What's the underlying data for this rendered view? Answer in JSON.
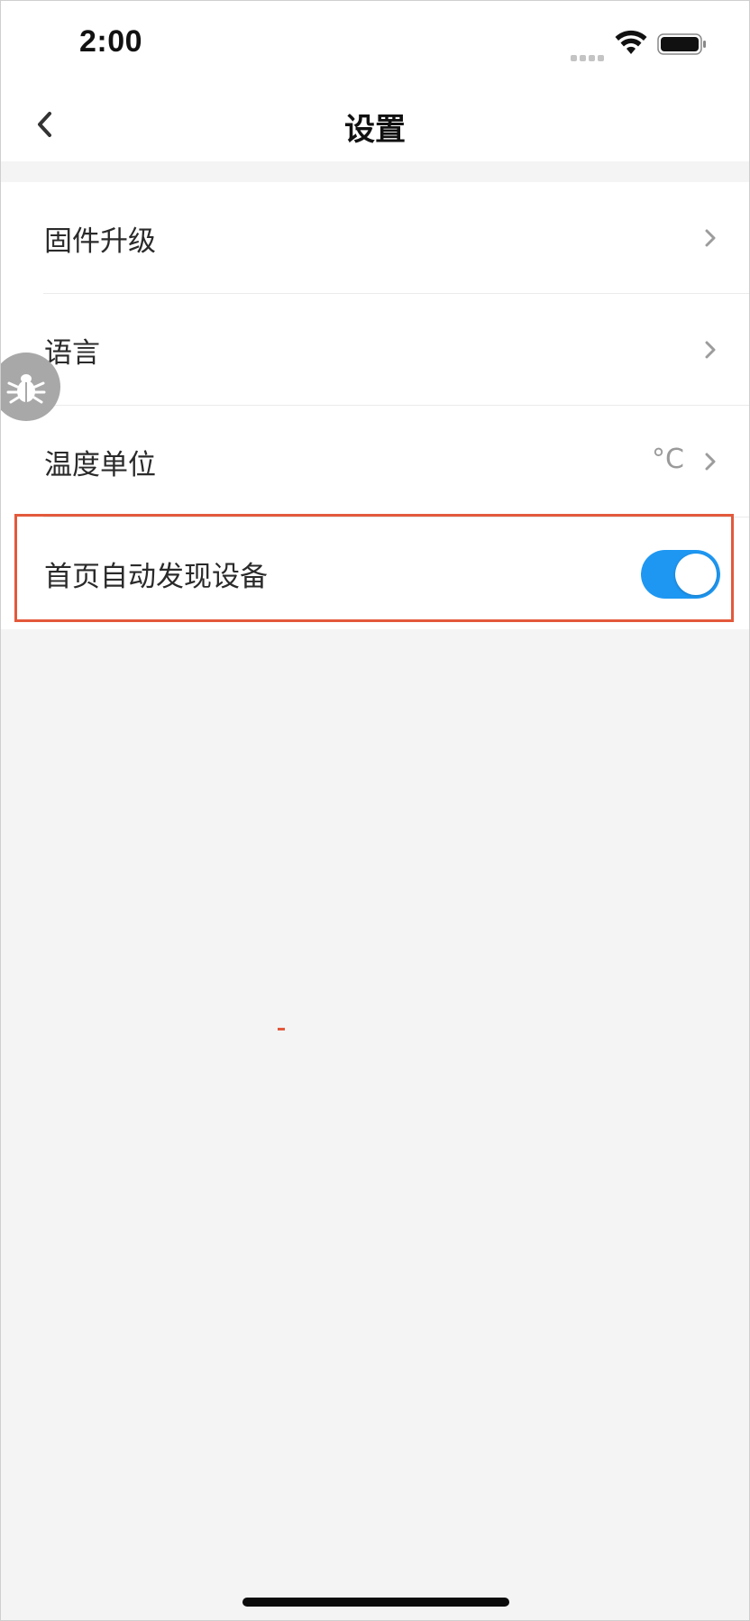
{
  "status_bar": {
    "time": "2:00"
  },
  "nav": {
    "title": "设置",
    "back_icon": "chevron-left-icon"
  },
  "settings": {
    "items": [
      {
        "label": "固件升级",
        "type": "link",
        "icon": "chevron-right-icon"
      },
      {
        "label": "语言",
        "type": "link",
        "icon": "chevron-right-icon"
      },
      {
        "label": "温度单位",
        "type": "link",
        "value": "°C",
        "icon": "chevron-right-icon"
      },
      {
        "label": "首页自动发现设备",
        "type": "toggle",
        "enabled": true
      }
    ]
  },
  "colors": {
    "accent": "#1e97f2",
    "highlight": "#e3593b",
    "background": "#f4f4f4"
  },
  "debug_icon": "bug-icon"
}
